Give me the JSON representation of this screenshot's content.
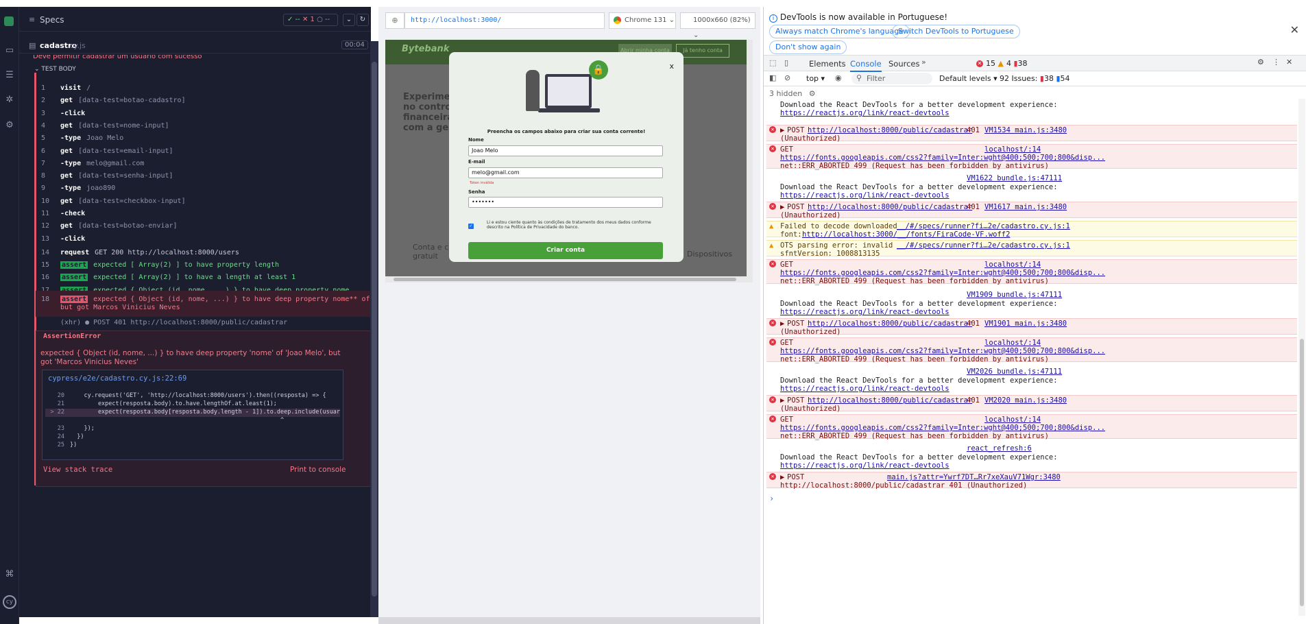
{
  "cypress": {
    "specs_label": "Specs",
    "pass_count": "✓ --",
    "fail_count": "✕ 1",
    "pending_count": "○ --",
    "spec_file": "cadastro",
    "spec_ext": ".cy.js",
    "duration": "00:04",
    "test_title": "Deve permitir cadastrar um usuário com sucesso",
    "test_body": "TEST BODY",
    "commands": [
      {
        "n": "1",
        "k": "visit",
        "v": "/"
      },
      {
        "n": "2",
        "k": "get",
        "v": "[data-test=botao-cadastro]"
      },
      {
        "n": "3",
        "k": "-click",
        "v": ""
      },
      {
        "n": "4",
        "k": "get",
        "v": "[data-test=nome-input]"
      },
      {
        "n": "5",
        "k": "-type",
        "v": "Joao Melo"
      },
      {
        "n": "6",
        "k": "get",
        "v": "[data-test=email-input]"
      },
      {
        "n": "7",
        "k": "-type",
        "v": "melo@gmail.com"
      },
      {
        "n": "8",
        "k": "get",
        "v": "[data-test=senha-input]"
      },
      {
        "n": "9",
        "k": "-type",
        "v": "joao890"
      },
      {
        "n": "10",
        "k": "get",
        "v": "[data-test=checkbox-input]"
      },
      {
        "n": "11",
        "k": "-check",
        "v": ""
      },
      {
        "n": "12",
        "k": "get",
        "v": "[data-test=botao-enviar]"
      },
      {
        "n": "13",
        "k": "-click",
        "v": ""
      }
    ],
    "request": {
      "n": "14",
      "k": "request",
      "v": "GET 200 http://localhost:8000/users"
    },
    "asserts": [
      {
        "n": "15",
        "tag": "assert",
        "text": "expected [ Array(2) ] to have property length"
      },
      {
        "n": "16",
        "tag": "assert",
        "text": "expected [ Array(2) ] to have a length at least 1"
      },
      {
        "n": "17",
        "tag": "assert",
        "text": "expected { Object (id, nome, ...) } to have deep property nome"
      }
    ],
    "failed": {
      "n": "18",
      "tag": "assert",
      "text": "expected { Object (id, nome, ...) } to have deep property nome** of **Joao Melo ,",
      "text2": "but got Marcos Vinicius Neves"
    },
    "xhr": "(xhr)  ● POST 401 http://localhost:8000/public/cadastrar",
    "error_name": "AssertionError",
    "error_message": "expected { Object (id, nome, ...) } to have deep property 'nome' of 'Joao Melo', but got 'Marcos Vinicius Neves'",
    "file_link": "cypress/e2e/cadastro.cy.js:22:69",
    "code": [
      {
        "n": "20",
        "t": "    cy.request('GET', 'http://localhost:8000/users').then((resposta) => {"
      },
      {
        "n": "21",
        "t": "        expect(resposta.body).to.have.lengthOf.at.least(1);"
      },
      {
        "n": "> 22",
        "t": "        expect(resposta.body[resposta.body.length - 1]).to.deep.include(usuario);"
      },
      {
        "n": "",
        "t": "                                                            ^"
      },
      {
        "n": "23",
        "t": "    });"
      },
      {
        "n": "24",
        "t": "  })"
      },
      {
        "n": "25",
        "t": "})"
      }
    ],
    "view_stack": "View stack trace",
    "print_console": "Print to console"
  },
  "browser": {
    "url": "http://localhost:3000/",
    "browser_name": "Chrome 131",
    "viewport": "1000x660 (82%)"
  },
  "app": {
    "brand": "Bytebank",
    "header_btn1": "Abrir minha conta",
    "header_btn2": "Já tenho conta",
    "hero": [
      "Experimente",
      "no controle",
      "financeira",
      "com a gen"
    ],
    "card1": "Conta e c\ngratuit",
    "card2": "Dispositivos",
    "modal": {
      "close": "x",
      "heading": "Preencha os campos abaixo para criar sua conta corrente!",
      "nome_label": "Nome",
      "nome_value": "Joao Melo",
      "email_label": "E-mail",
      "email_value": "melo@gmail.com",
      "email_error": "Token inválida",
      "senha_label": "Senha",
      "senha_value": "•••••••",
      "terms": "Li e estou ciente quanto às condições de tratamento dos meus dados conforme descrito na Política de Privacidade do banco.",
      "submit": "Criar conta"
    }
  },
  "devtools": {
    "lang_notice": "DevTools is now available in Portuguese!",
    "btn_match": "Always match Chrome's language",
    "btn_switch": "Switch DevTools to Portuguese",
    "btn_dont": "Don't show again",
    "tabs": [
      "Elements",
      "Console",
      "Sources"
    ],
    "err_count": "15",
    "warn_count": "4",
    "issue_count": "38",
    "context": "top",
    "filter_placeholder": "Filter",
    "levels": "Default levels",
    "issues": "92 Issues:",
    "issues_err": "38",
    "issues_warn": "54",
    "hidden": "3 hidden",
    "react_msg": "Download the React DevTools for a better development experience:",
    "react_link": "https://reactjs.org/link/react-devtools",
    "post_url": "http://localhost:8000/public/cadastrar",
    "unauth": "(Unauthorized)",
    "fonts_url": "https://fonts.googleapis.com/css2?family=Inter:wght@400;500;700;800&disp...",
    "aborted": "net::ERR_ABORTED 499 (Request has been forbidden by antivirus)",
    "localhost14": "localhost/:14",
    "decode_fail": "Failed to decode downloaded",
    "decode_src": "__/#/specs/runner?fi…2e/cadastro.cy.js:1",
    "font_line": "font: ",
    "font_url": "http://localhost:3000/__/fonts/FiraCode-VF.woff2",
    "ots": "OTS parsing error: invalid",
    "sfnt": "sfntVersion: 1008813135",
    "vm1534": "VM1534 main.js:3480",
    "vm1622": "VM1622 bundle.js:47111",
    "vm1617": "VM1617 main.js:3480",
    "vm1909": "VM1909 bundle.js:47111",
    "vm1901": "VM1901 main.js:3480",
    "vm2026": "VM2026 bundle.js:47111",
    "vm2020": "VM2020 main.js:3480",
    "react_refresh": "react_refresh:6",
    "mainjs_attr": "main.js?attr=Ywrf7DT…Rr7xeXauV71Wgr:3480",
    "post_last": "http://localhost:8000/public/cadastrar 401 (Unauthorized)",
    "post_label": "POST",
    "get_label": "GET",
    "code401": "401"
  }
}
